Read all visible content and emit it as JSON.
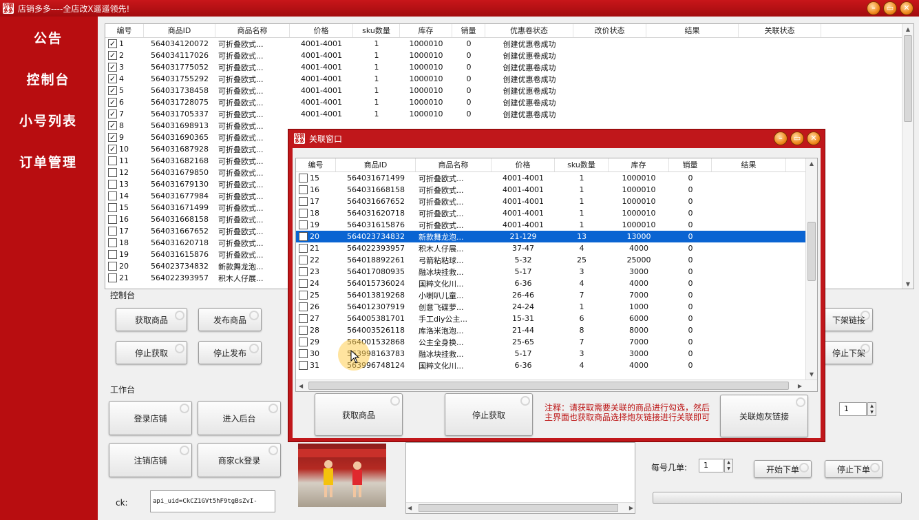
{
  "window": {
    "title": "店销多多----全店改X遥遥领先!",
    "app_icon": "店销多多",
    "buttons": [
      "–",
      "▭",
      "✕"
    ]
  },
  "sidebar": {
    "items": [
      "公告",
      "控制台",
      "小号列表",
      "订单管理"
    ]
  },
  "main_grid": {
    "columns": [
      "编号",
      "商品ID",
      "商品名称",
      "价格",
      "sku数量",
      "库存",
      "销量",
      "优惠卷状态",
      "改价状态",
      "结果",
      "关联状态"
    ],
    "rows": [
      {
        "checked": true,
        "no": "1",
        "id": "564034120072",
        "name": "可折叠欧式...",
        "price": "4001-4001",
        "sku": "1",
        "stock": "1000010",
        "sales": "0",
        "coupon": "创建优惠卷成功"
      },
      {
        "checked": true,
        "no": "2",
        "id": "564034117026",
        "name": "可折叠欧式...",
        "price": "4001-4001",
        "sku": "1",
        "stock": "1000010",
        "sales": "0",
        "coupon": "创建优惠卷成功"
      },
      {
        "checked": true,
        "no": "3",
        "id": "564031775052",
        "name": "可折叠欧式...",
        "price": "4001-4001",
        "sku": "1",
        "stock": "1000010",
        "sales": "0",
        "coupon": "创建优惠卷成功"
      },
      {
        "checked": true,
        "no": "4",
        "id": "564031755292",
        "name": "可折叠欧式...",
        "price": "4001-4001",
        "sku": "1",
        "stock": "1000010",
        "sales": "0",
        "coupon": "创建优惠卷成功"
      },
      {
        "checked": true,
        "no": "5",
        "id": "564031738458",
        "name": "可折叠欧式...",
        "price": "4001-4001",
        "sku": "1",
        "stock": "1000010",
        "sales": "0",
        "coupon": "创建优惠卷成功"
      },
      {
        "checked": true,
        "no": "6",
        "id": "564031728075",
        "name": "可折叠欧式...",
        "price": "4001-4001",
        "sku": "1",
        "stock": "1000010",
        "sales": "0",
        "coupon": "创建优惠卷成功"
      },
      {
        "checked": true,
        "no": "7",
        "id": "564031705337",
        "name": "可折叠欧式...",
        "price": "4001-4001",
        "sku": "1",
        "stock": "1000010",
        "sales": "0",
        "coupon": "创建优惠卷成功"
      },
      {
        "checked": true,
        "no": "8",
        "id": "564031698913",
        "name": "可折叠欧式...",
        "price": "",
        "sku": "",
        "stock": "",
        "sales": "",
        "coupon": ""
      },
      {
        "checked": true,
        "no": "9",
        "id": "564031690365",
        "name": "可折叠欧式...",
        "price": "",
        "sku": "",
        "stock": "",
        "sales": "",
        "coupon": ""
      },
      {
        "checked": true,
        "no": "10",
        "id": "564031687928",
        "name": "可折叠欧式...",
        "price": "",
        "sku": "",
        "stock": "",
        "sales": "",
        "coupon": ""
      },
      {
        "checked": false,
        "no": "11",
        "id": "564031682168",
        "name": "可折叠欧式...",
        "price": "",
        "sku": "",
        "stock": "",
        "sales": "",
        "coupon": ""
      },
      {
        "checked": false,
        "no": "12",
        "id": "564031679850",
        "name": "可折叠欧式...",
        "price": "",
        "sku": "",
        "stock": "",
        "sales": "",
        "coupon": ""
      },
      {
        "checked": false,
        "no": "13",
        "id": "564031679130",
        "name": "可折叠欧式...",
        "price": "",
        "sku": "",
        "stock": "",
        "sales": "",
        "coupon": ""
      },
      {
        "checked": false,
        "no": "14",
        "id": "564031677984",
        "name": "可折叠欧式...",
        "price": "",
        "sku": "",
        "stock": "",
        "sales": "",
        "coupon": ""
      },
      {
        "checked": false,
        "no": "15",
        "id": "564031671499",
        "name": "可折叠欧式...",
        "price": "",
        "sku": "",
        "stock": "",
        "sales": "",
        "coupon": ""
      },
      {
        "checked": false,
        "no": "16",
        "id": "564031668158",
        "name": "可折叠欧式...",
        "price": "",
        "sku": "",
        "stock": "",
        "sales": "",
        "coupon": ""
      },
      {
        "checked": false,
        "no": "17",
        "id": "564031667652",
        "name": "可折叠欧式...",
        "price": "",
        "sku": "",
        "stock": "",
        "sales": "",
        "coupon": ""
      },
      {
        "checked": false,
        "no": "18",
        "id": "564031620718",
        "name": "可折叠欧式...",
        "price": "",
        "sku": "",
        "stock": "",
        "sales": "",
        "coupon": ""
      },
      {
        "checked": false,
        "no": "19",
        "id": "564031615876",
        "name": "可折叠欧式...",
        "price": "",
        "sku": "",
        "stock": "",
        "sales": "",
        "coupon": ""
      },
      {
        "checked": false,
        "no": "20",
        "id": "564023734832",
        "name": "新款舞龙泡...",
        "price": "",
        "sku": "",
        "stock": "",
        "sales": "",
        "coupon": ""
      },
      {
        "checked": false,
        "no": "21",
        "id": "564022393957",
        "name": "积木人仔展...",
        "price": "",
        "sku": "",
        "stock": "",
        "sales": "",
        "coupon": ""
      }
    ]
  },
  "console": {
    "label": "控制台",
    "get_products": "获取商品",
    "publish": "发布商品",
    "stop_get": "停止获取",
    "stop_publish": "停止发布",
    "unlist_link": "下架链接",
    "stop_unlist": "停止下架"
  },
  "workbench": {
    "label": "工作台",
    "login_shop": "登录店铺",
    "enter_backend": "进入后台",
    "logout_shop": "注销店铺",
    "merchant_ck_login": "商家ck登录",
    "ck_label": "ck:",
    "ck_value": "api_uid=CkCZ1GVt5hF9tgBsZvI-",
    "per_account_label": "每号几单:",
    "per_account_value": "1",
    "spin_top_value": "1",
    "start_order": "开始下单",
    "stop_order": "停止下单"
  },
  "modal": {
    "title": "关联窗口",
    "columns": [
      "编号",
      "商品ID",
      "商品名称",
      "价格",
      "sku数量",
      "库存",
      "销量",
      "结果"
    ],
    "rows": [
      {
        "no": "15",
        "id": "564031671499",
        "name": "可折叠欧式...",
        "price": "4001-4001",
        "sku": "1",
        "stock": "1000010",
        "sales": "0"
      },
      {
        "no": "16",
        "id": "564031668158",
        "name": "可折叠欧式...",
        "price": "4001-4001",
        "sku": "1",
        "stock": "1000010",
        "sales": "0"
      },
      {
        "no": "17",
        "id": "564031667652",
        "name": "可折叠欧式...",
        "price": "4001-4001",
        "sku": "1",
        "stock": "1000010",
        "sales": "0"
      },
      {
        "no": "18",
        "id": "564031620718",
        "name": "可折叠欧式...",
        "price": "4001-4001",
        "sku": "1",
        "stock": "1000010",
        "sales": "0"
      },
      {
        "no": "19",
        "id": "564031615876",
        "name": "可折叠欧式...",
        "price": "4001-4001",
        "sku": "1",
        "stock": "1000010",
        "sales": "0"
      },
      {
        "no": "20",
        "id": "564023734832",
        "name": "新款舞龙泡...",
        "price": "21-129",
        "sku": "13",
        "stock": "13000",
        "sales": "0",
        "selected": true
      },
      {
        "no": "21",
        "id": "564022393957",
        "name": "积木人仔展...",
        "price": "37-47",
        "sku": "4",
        "stock": "4000",
        "sales": "0"
      },
      {
        "no": "22",
        "id": "564018892261",
        "name": "弓箭粘粘球...",
        "price": "5-32",
        "sku": "25",
        "stock": "25000",
        "sales": "0"
      },
      {
        "no": "23",
        "id": "564017080935",
        "name": "融冰块挂救...",
        "price": "5-17",
        "sku": "3",
        "stock": "3000",
        "sales": "0"
      },
      {
        "no": "24",
        "id": "564015736024",
        "name": "国粹文化川...",
        "price": "6-36",
        "sku": "4",
        "stock": "4000",
        "sales": "0"
      },
      {
        "no": "25",
        "id": "564013819268",
        "name": "小喇叭儿童...",
        "price": "26-46",
        "sku": "7",
        "stock": "7000",
        "sales": "0"
      },
      {
        "no": "26",
        "id": "564012307919",
        "name": "创意飞碟萝...",
        "price": "24-24",
        "sku": "1",
        "stock": "1000",
        "sales": "0"
      },
      {
        "no": "27",
        "id": "564005381701",
        "name": "手工diy公主...",
        "price": "15-31",
        "sku": "6",
        "stock": "6000",
        "sales": "0"
      },
      {
        "no": "28",
        "id": "564003526118",
        "name": "库洛米泡泡...",
        "price": "21-44",
        "sku": "8",
        "stock": "8000",
        "sales": "0"
      },
      {
        "no": "29",
        "id": "564001532868",
        "name": "公主全身换...",
        "price": "25-65",
        "sku": "7",
        "stock": "7000",
        "sales": "0"
      },
      {
        "no": "30",
        "id": "563998163783",
        "name": "融冰块挂救...",
        "price": "5-17",
        "sku": "3",
        "stock": "3000",
        "sales": "0"
      },
      {
        "no": "31",
        "id": "563996748124",
        "name": "国粹文化川...",
        "price": "6-36",
        "sku": "4",
        "stock": "4000",
        "sales": "0"
      }
    ],
    "get_products": "获取商品",
    "stop_get": "停止获取",
    "note": "注释：请获取需要关联的商品进行勾选，然后主界面也获取商品选择炮灰链接进行关联即可",
    "link_button": "关联炮灰链接"
  },
  "colors": {
    "brand_red": "#b90f12",
    "selection_blue": "#0a64d2",
    "note_red": "#b11111"
  }
}
